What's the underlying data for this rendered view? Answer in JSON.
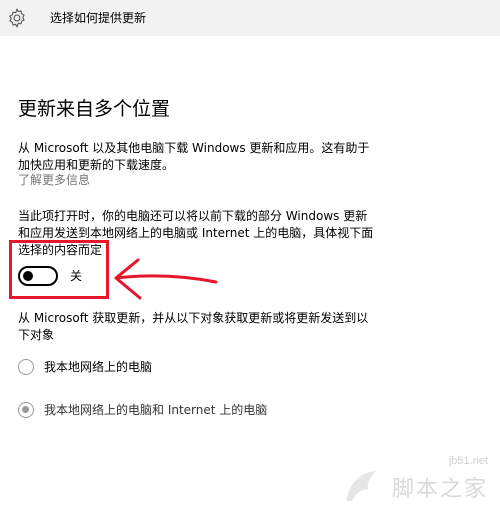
{
  "window": {
    "title": "选择如何提供更新",
    "icon": "gear-icon"
  },
  "page": {
    "heading": "更新来自多个位置",
    "description_lines": [
      "从 Microsoft 以及其他电脑下载 Windows 更新和应用。这有助于",
      "加快应用和更新的下载速度。"
    ],
    "learn_more": "了解更多信息",
    "toggle_description_lines": [
      "当此项打开时，你的电脑还可以将以前下载的部分 Windows 更新",
      "和应用发送到本地网络上的电脑或 Internet 上的电脑，具体视下面",
      "选择的内容而定"
    ],
    "toggle": {
      "state": "off",
      "label": "关"
    },
    "source_description_lines": [
      "从 Microsoft 获取更新，并从以下对象获取更新或将更新发送到以",
      "下对象"
    ],
    "options": [
      {
        "label": "我本地网络上的电脑",
        "selected": false
      },
      {
        "label": "我本地网络上的电脑和 Internet 上的电脑",
        "selected": true
      }
    ]
  },
  "annotation": {
    "color": "#e8162a"
  },
  "watermark": {
    "url": "jb51.net",
    "text": "脚本之家"
  },
  "colors": {
    "titlebar_bg": "#f2f2f2",
    "link_gray": "#767676",
    "annotation_red": "#e8162a"
  }
}
